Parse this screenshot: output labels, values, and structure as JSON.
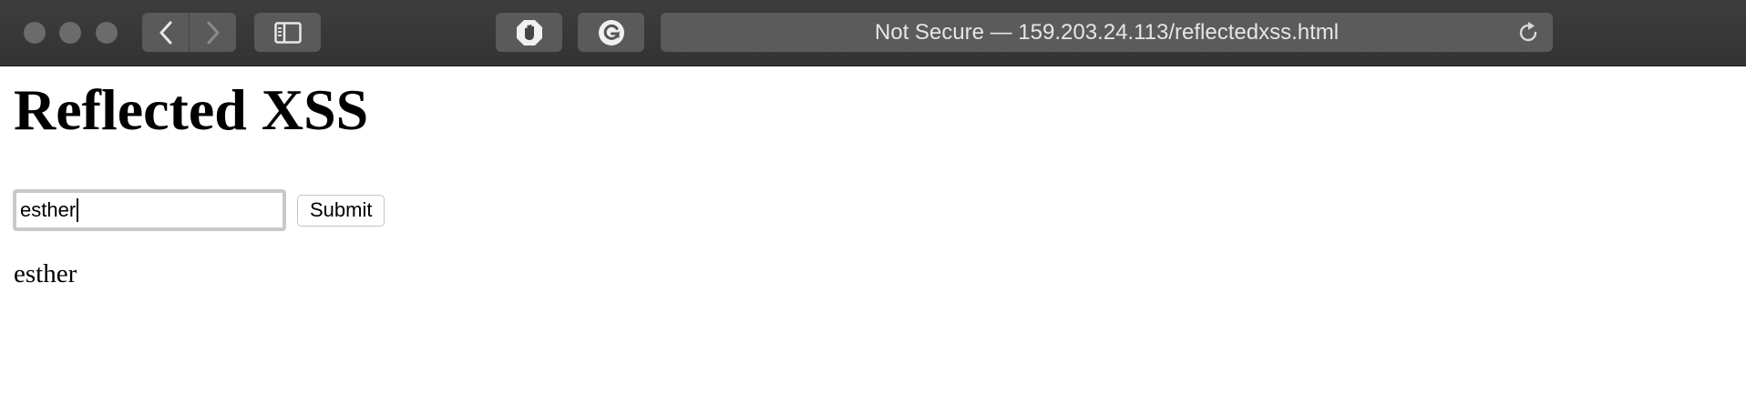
{
  "browser": {
    "url_display": "Not Secure — 159.203.24.113/reflectedxss.html",
    "icons": {
      "back": "chevron-left-icon",
      "forward": "chevron-right-icon",
      "sidebar": "sidebar-icon",
      "adblock": "hand-stop-icon",
      "extension": "grammarly-icon",
      "reload": "reload-icon"
    }
  },
  "page": {
    "heading": "Reflected XSS",
    "input_value": "esther",
    "submit_label": "Submit",
    "reflected_output": "esther"
  }
}
